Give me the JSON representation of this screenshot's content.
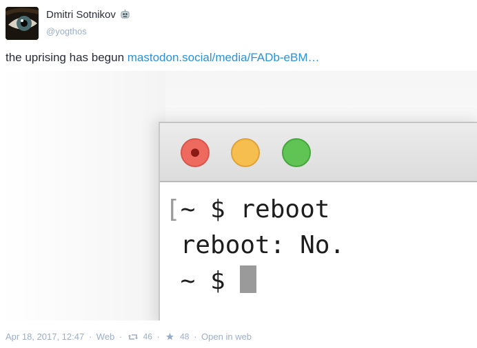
{
  "status": {
    "author": {
      "display_name": "Dmitri Sotnikov",
      "username": "@yogthos",
      "avatar_icon": "eye-avatar",
      "badge_icon": "robot-emoji-icon"
    },
    "text": "the uprising has begun ",
    "link_text": "mastodon.social/media/FADb-eBM…"
  },
  "media": {
    "terminal_lines": {
      "line1_bracket": "[",
      "line1": "~ $ reboot",
      "line2": " reboot: No.",
      "line3": " ~ $ "
    },
    "window_buttons": [
      "close",
      "minimize",
      "zoom"
    ]
  },
  "footer": {
    "timestamp": "Apr 18, 2017, 12:47",
    "dot1": "·",
    "app": "Web",
    "dot2": "·",
    "reblog_icon": "retweet-icon",
    "reblogs": "46",
    "dot3": "·",
    "favourite_icon": "star-icon",
    "favourites": "48",
    "dot4": "·",
    "open_in_web": "Open in web"
  },
  "colors": {
    "link": "#2b90d9",
    "muted": "#9baec8",
    "text": "#282c37"
  }
}
